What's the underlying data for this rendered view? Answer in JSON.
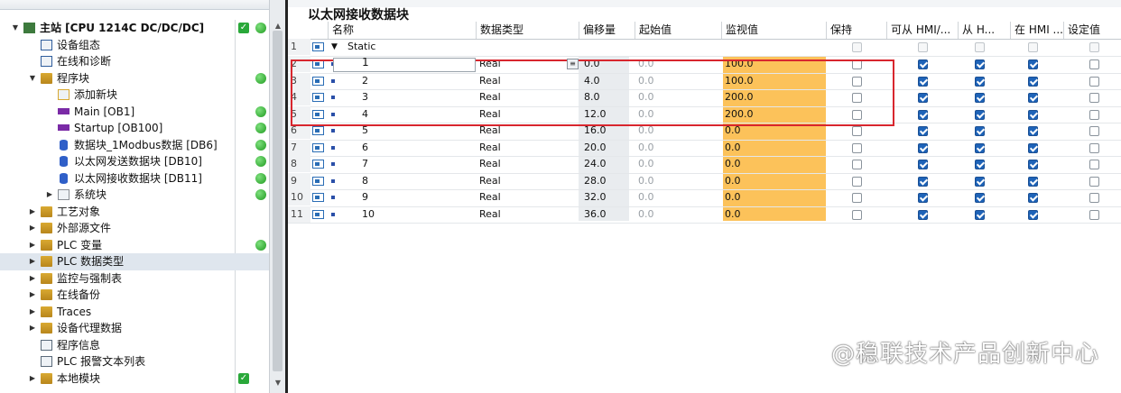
{
  "tree": {
    "items": [
      {
        "label": "主站 [CPU 1214C DC/DC/DC]",
        "indent": 0,
        "twisty": "▼",
        "icon": "cpu",
        "status": [
          "check",
          "green"
        ],
        "bold": true
      },
      {
        "label": "设备组态",
        "indent": 1,
        "twisty": "",
        "icon": "device-config"
      },
      {
        "label": "在线和诊断",
        "indent": 1,
        "twisty": "",
        "icon": "online-diagnostics"
      },
      {
        "label": "程序块",
        "indent": 1,
        "twisty": "▼",
        "icon": "folder",
        "status": [
          "green"
        ]
      },
      {
        "label": "添加新块",
        "indent": 2,
        "twisty": "",
        "icon": "add-block"
      },
      {
        "label": "Main [OB1]",
        "indent": 2,
        "twisty": "",
        "icon": "ob",
        "status": [
          "green"
        ]
      },
      {
        "label": "Startup [OB100]",
        "indent": 2,
        "twisty": "",
        "icon": "ob",
        "status": [
          "green"
        ]
      },
      {
        "label": "数据块_1Modbus数据 [DB6]",
        "indent": 2,
        "twisty": "",
        "icon": "db",
        "status": [
          "green"
        ]
      },
      {
        "label": "以太网发送数据块 [DB10]",
        "indent": 2,
        "twisty": "",
        "icon": "db",
        "status": [
          "green"
        ]
      },
      {
        "label": "以太网接收数据块 [DB11]",
        "indent": 2,
        "twisty": "",
        "icon": "db",
        "status": [
          "green"
        ]
      },
      {
        "label": "系统块",
        "indent": 2,
        "twisty": "▶",
        "icon": "system-block",
        "status": [
          "green"
        ]
      },
      {
        "label": "工艺对象",
        "indent": 1,
        "twisty": "▶",
        "icon": "folder"
      },
      {
        "label": "外部源文件",
        "indent": 1,
        "twisty": "▶",
        "icon": "folder"
      },
      {
        "label": "PLC 变量",
        "indent": 1,
        "twisty": "▶",
        "icon": "folder",
        "status": [
          "green"
        ]
      },
      {
        "label": "PLC 数据类型",
        "indent": 1,
        "twisty": "▶",
        "icon": "folder",
        "selected": true
      },
      {
        "label": "监控与强制表",
        "indent": 1,
        "twisty": "▶",
        "icon": "folder"
      },
      {
        "label": "在线备份",
        "indent": 1,
        "twisty": "▶",
        "icon": "folder"
      },
      {
        "label": "Traces",
        "indent": 1,
        "twisty": "▶",
        "icon": "folder"
      },
      {
        "label": "设备代理数据",
        "indent": 1,
        "twisty": "▶",
        "icon": "folder"
      },
      {
        "label": "程序信息",
        "indent": 1,
        "twisty": "",
        "icon": "program-info"
      },
      {
        "label": "PLC 报警文本列表",
        "indent": 1,
        "twisty": "",
        "icon": "alarm-text"
      },
      {
        "label": "本地模块",
        "indent": 1,
        "twisty": "▶",
        "icon": "folder",
        "status": [
          "check"
        ]
      }
    ]
  },
  "editor": {
    "title": "以太网接收数据块",
    "columns": [
      "名称",
      "数据类型",
      "偏移量",
      "起始值",
      "监视值",
      "保持",
      "可从 HMI/...",
      "从 H...",
      "在 HMI ...",
      "设定值"
    ],
    "static_row": {
      "num": "1",
      "name": "Static"
    },
    "rows": [
      {
        "num": "2",
        "name": "1",
        "type": "Real",
        "offset": "0.0",
        "start": "0.0",
        "monitor": "100.0"
      },
      {
        "num": "3",
        "name": "2",
        "type": "Real",
        "offset": "4.0",
        "start": "0.0",
        "monitor": "100.0"
      },
      {
        "num": "4",
        "name": "3",
        "type": "Real",
        "offset": "8.0",
        "start": "0.0",
        "monitor": "200.0"
      },
      {
        "num": "5",
        "name": "4",
        "type": "Real",
        "offset": "12.0",
        "start": "0.0",
        "monitor": "200.0"
      },
      {
        "num": "6",
        "name": "5",
        "type": "Real",
        "offset": "16.0",
        "start": "0.0",
        "monitor": "0.0"
      },
      {
        "num": "7",
        "name": "6",
        "type": "Real",
        "offset": "20.0",
        "start": "0.0",
        "monitor": "0.0"
      },
      {
        "num": "8",
        "name": "7",
        "type": "Real",
        "offset": "24.0",
        "start": "0.0",
        "monitor": "0.0"
      },
      {
        "num": "9",
        "name": "8",
        "type": "Real",
        "offset": "28.0",
        "start": "0.0",
        "monitor": "0.0"
      },
      {
        "num": "10",
        "name": "9",
        "type": "Real",
        "offset": "32.0",
        "start": "0.0",
        "monitor": "0.0"
      },
      {
        "num": "11",
        "name": "10",
        "type": "Real",
        "offset": "36.0",
        "start": "0.0",
        "monitor": "0.0"
      }
    ],
    "checkbox_state": {
      "retain": false,
      "hmi_access": true,
      "hmi_write": true,
      "hmi_visible": true,
      "setpoint": false
    }
  },
  "colors": {
    "monitor_bg": "#fcc25a",
    "highlight_border": "#d8262e",
    "status_green": "#2aa83a",
    "checkbox_on": "#1e63b8"
  },
  "watermark": "@稳联技术产品创新中心"
}
